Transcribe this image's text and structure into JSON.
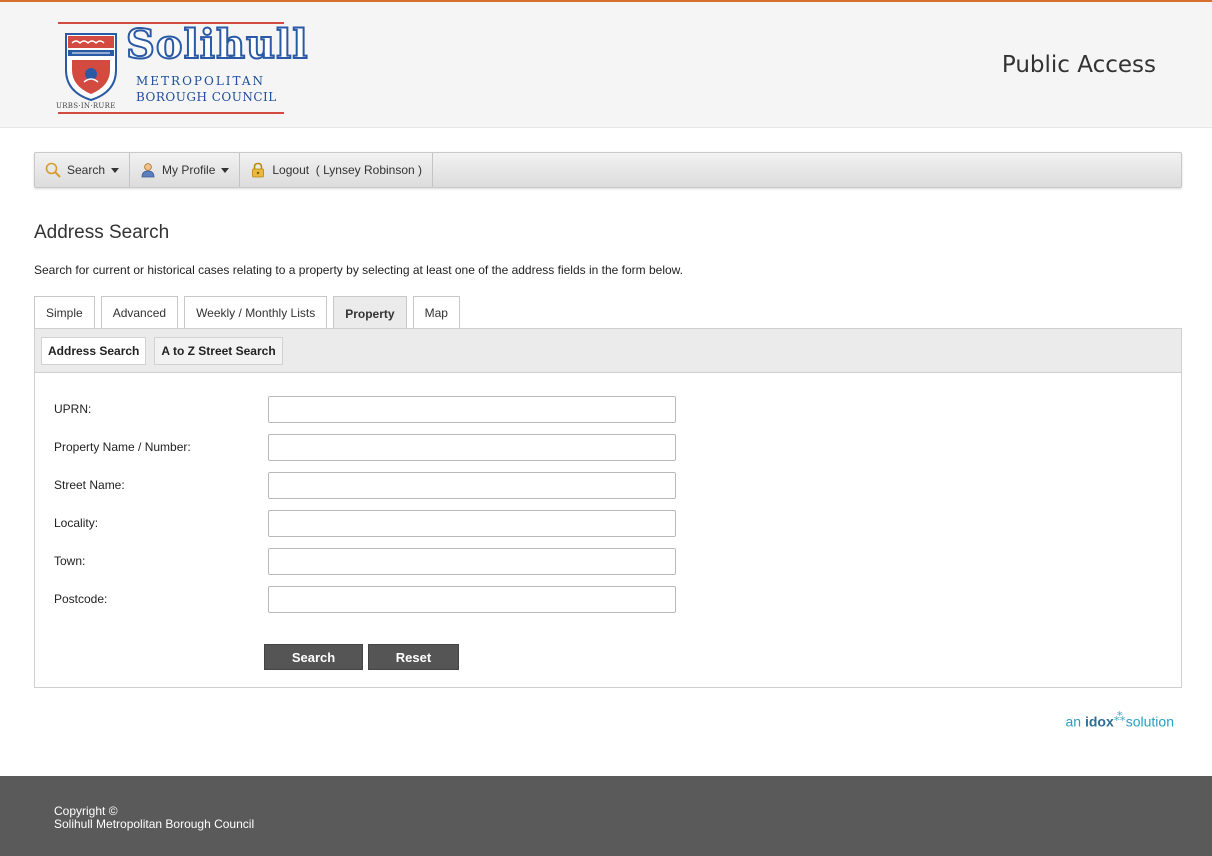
{
  "header": {
    "logo": {
      "name": "Solihull",
      "line1": "METROPOLITAN",
      "line2": "BOROUGH COUNCIL",
      "motto": "URBS·IN·RURE"
    },
    "app_title": "Public Access"
  },
  "nav": {
    "search": "Search",
    "profile": "My Profile",
    "logout": "Logout  ( Lynsey Robinson )"
  },
  "page": {
    "title": "Address Search",
    "intro": "Search for current or historical cases relating to a property by selecting at least one of the address fields in the form below."
  },
  "tabs": [
    "Simple",
    "Advanced",
    "Weekly / Monthly Lists",
    "Property",
    "Map"
  ],
  "active_tab": "Property",
  "subtabs": [
    "Address Search",
    "A to Z Street Search"
  ],
  "form": {
    "fields": [
      {
        "label": "UPRN:",
        "value": ""
      },
      {
        "label": "Property Name / Number:",
        "value": ""
      },
      {
        "label": "Street Name:",
        "value": ""
      },
      {
        "label": "Locality:",
        "value": ""
      },
      {
        "label": "Town:",
        "value": ""
      },
      {
        "label": "Postcode:",
        "value": ""
      }
    ],
    "search_button": "Search",
    "reset_button": "Reset"
  },
  "branding": {
    "prefix": "an",
    "brand": "idox",
    "suffix": "solution"
  },
  "footer": {
    "line1": "Copyright ©",
    "line2": "Solihull Metropolitan Borough Council"
  },
  "colors": {
    "accent_orange": "#d8702d",
    "logo_blue": "#2a5aa5",
    "logo_red": "#d34a40",
    "button_grey": "#555555",
    "footer_grey": "#5a5a5a"
  }
}
